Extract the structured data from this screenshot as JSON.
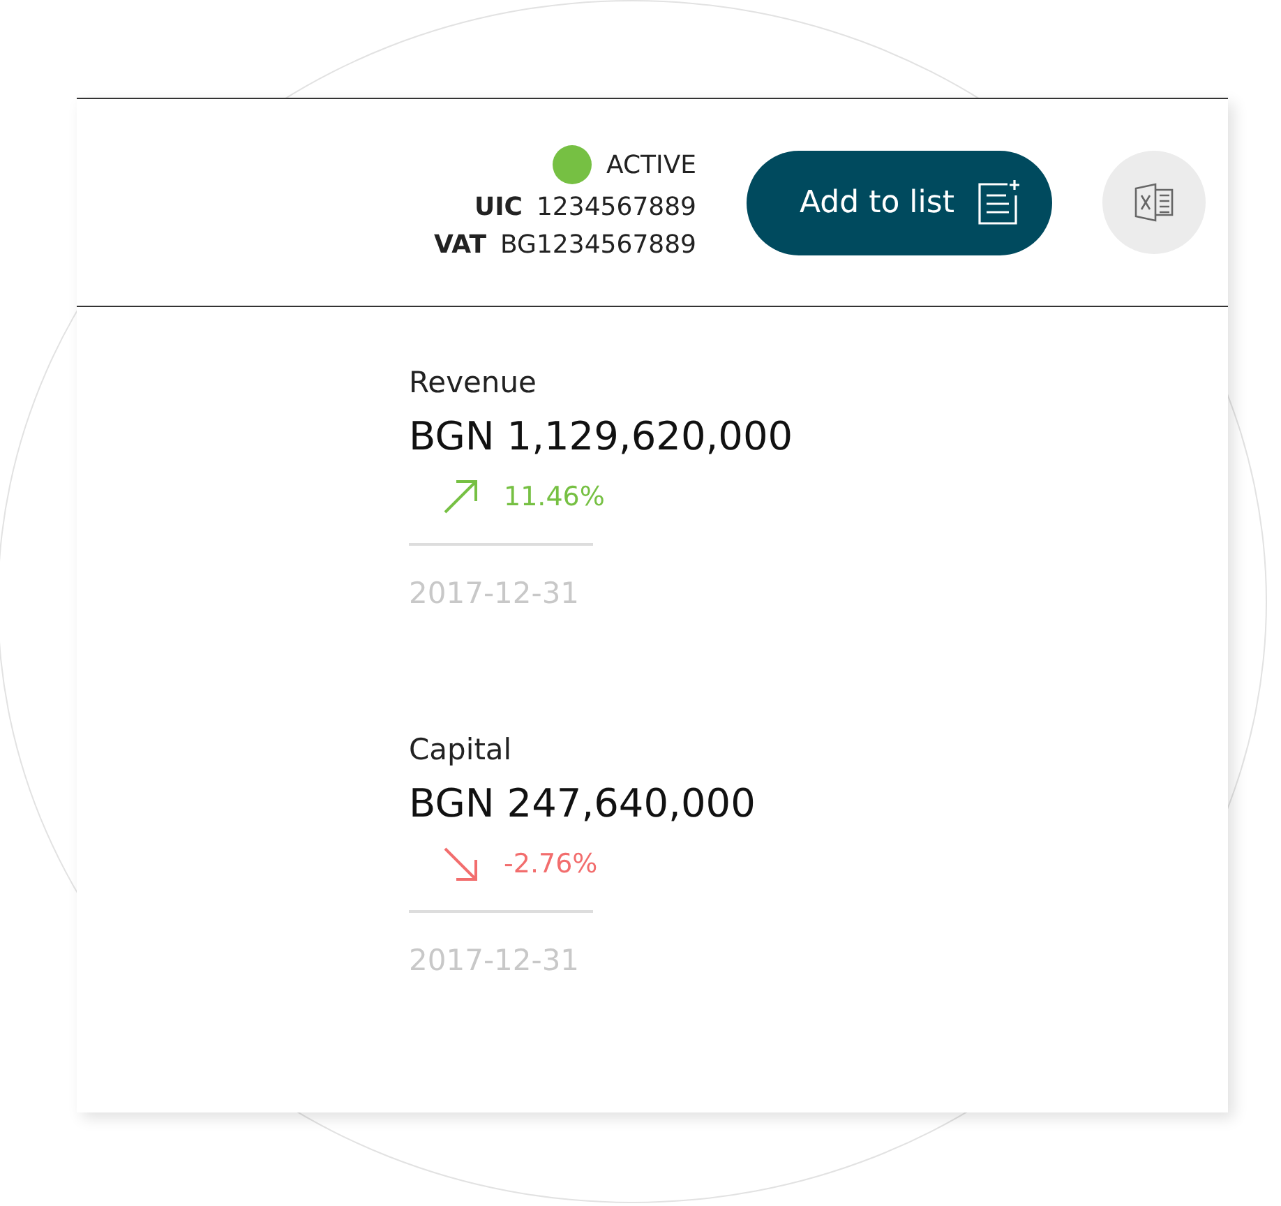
{
  "company": {
    "status": {
      "label": "ACTIVE",
      "color": "#76c043"
    },
    "ids": [
      {
        "label": "UIC",
        "value": "1234567889"
      },
      {
        "label": "VAT",
        "value": "BG1234567889"
      }
    ]
  },
  "add_button": {
    "label": "Add to list"
  },
  "metrics": [
    {
      "title": "Revenue",
      "amount": "BGN 1,129,620,000",
      "kind": "up",
      "change": "11.46%",
      "date": "2017-12-31"
    },
    {
      "title": "Capital",
      "amount": "BGN 247,640,000",
      "kind": "down",
      "change": "-2.76%",
      "date": "2017-12-31"
    }
  ]
}
